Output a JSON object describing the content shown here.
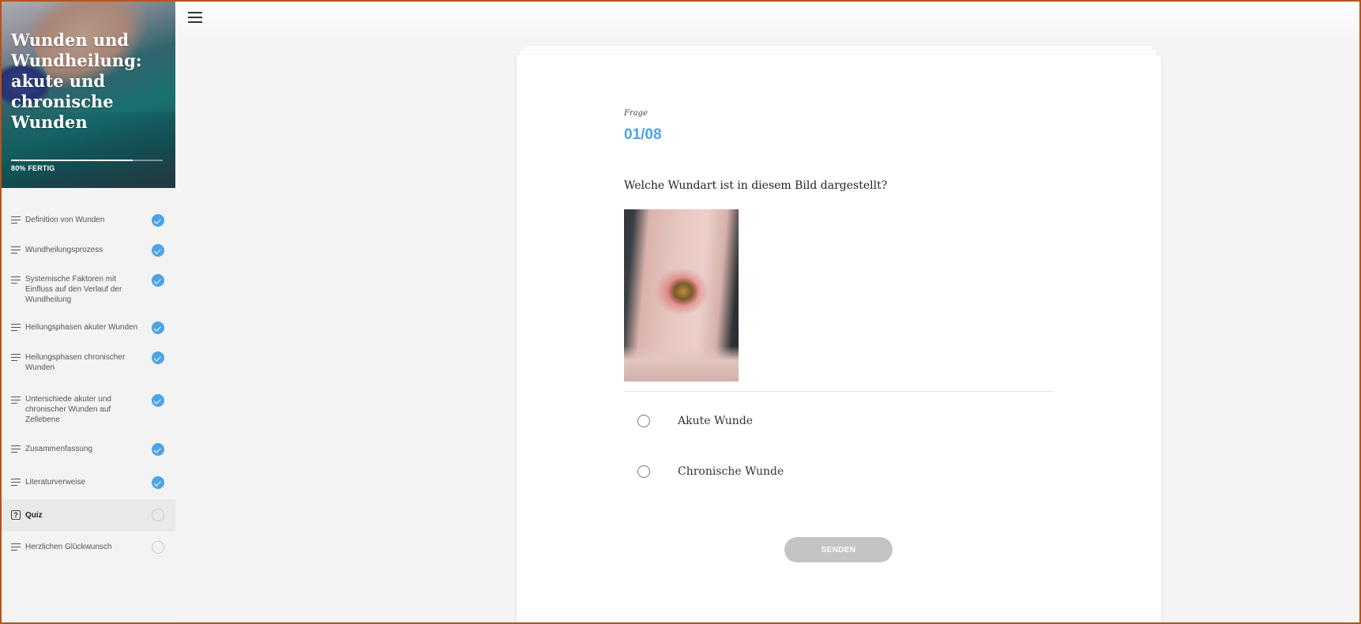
{
  "course": {
    "title": "Wunden und Wundheilung: akute und chronische Wunden",
    "progress_percent": 80,
    "progress_label": "80% FERTIG"
  },
  "sidebar": {
    "items": [
      {
        "label": "Definition von Wunden",
        "status": "complete",
        "icon": "lines-icon"
      },
      {
        "label": "Wundheilungsprozess",
        "status": "complete",
        "icon": "lines-icon"
      },
      {
        "label": "Systemische Faktoren mit Einfluss auf den Verlauf der Wundheilung",
        "status": "complete",
        "icon": "lines-icon"
      },
      {
        "label": "Heilungsphasen akuter Wunden",
        "status": "complete",
        "icon": "lines-icon"
      },
      {
        "label": "Heilungsphasen chronischer Wunden",
        "status": "complete",
        "icon": "lines-icon"
      },
      {
        "label": "Unterschiede akuter und chronischer Wunden auf Zellebene",
        "status": "complete",
        "icon": "lines-icon"
      },
      {
        "label": "Zusammenfassung",
        "status": "complete",
        "icon": "lines-icon"
      },
      {
        "label": "Literaturverweise",
        "status": "complete",
        "icon": "lines-icon"
      },
      {
        "label": "Quiz",
        "status": "incomplete",
        "icon": "quiz-icon",
        "active": true
      },
      {
        "label": "Herzlichen Glückwunsch",
        "status": "incomplete",
        "icon": "lines-icon"
      }
    ]
  },
  "topbar": {
    "menu_icon": "hamburger-menu-icon"
  },
  "quiz": {
    "label": "Frage",
    "counter": "01/08",
    "question": "Welche Wundart ist in diesem Bild dargestellt?",
    "options": [
      {
        "label": "Akute Wunde"
      },
      {
        "label": "Chronische Wunde"
      }
    ],
    "submit_label": "SENDEN"
  },
  "colors": {
    "accent": "#4ca3e6",
    "submit_disabled": "#c4c4c4",
    "frame": "#b5531c"
  }
}
